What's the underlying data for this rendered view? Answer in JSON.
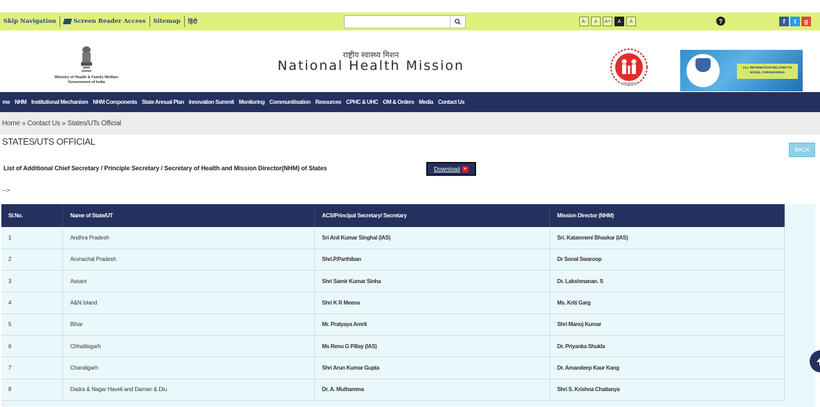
{
  "topbar": {
    "skip_navigation": "Skip Navigation",
    "screen_reader": "Screen Reader Access",
    "sitemap": "Sitemap",
    "hindi": "हिंदी",
    "search_placeholder": "",
    "search_icon": "search-icon",
    "font_sizes": [
      "A-",
      "A",
      "A+",
      "A",
      "A"
    ],
    "help_icon": "question-icon",
    "social": [
      {
        "icon": "facebook-icon",
        "glyph": "f",
        "color": "#3b5998"
      },
      {
        "icon": "twitter-icon",
        "glyph": "t",
        "color": "#1da1f2"
      },
      {
        "icon": "googleplus-icon",
        "glyph": "g",
        "color": "#dd4b39"
      }
    ]
  },
  "header": {
    "ministry_line1": "Ministry of Health & Family Welfare",
    "ministry_line2": "Government of India",
    "title_hindi": "राष्ट्रीय स्वास्थ्य मिशन",
    "title": "National Health Mission",
    "banner_text": "ALL INFORMATION RELATED TO NOVEL CORONAVIRUS"
  },
  "nav": {
    "items": [
      "me",
      "NHM",
      "Institutional Mechanism",
      "NHM Components",
      "State Annual Plan",
      "Innovation Summit",
      "Monitoring",
      "Communitisation",
      "Resources",
      "CPHC & UHC",
      "OM & Orders",
      "Media",
      "Contact Us"
    ]
  },
  "breadcrumb": "Home » Contact Us » States/UTs Official",
  "page": {
    "title": "STATES/UTS OFFICIAL",
    "back_label": "BACK",
    "list_heading": "List of Additional Chief Secretary / Principle Secretary / Secretary of Health and Mission Director(NHM) of States",
    "download_label": "Download",
    "arrow_text": "-->"
  },
  "table": {
    "headers": [
      "Sl.No.",
      "Name of State/UT",
      "ACS/Principal Secretary/ Secretary",
      "Mission Director (NHM)"
    ],
    "rows": [
      [
        "1",
        "Andhra Pradesh",
        "Sri Anil Kumar Singhal (IAS)",
        "Sri. Katamneni Bhaskar (IAS)"
      ],
      [
        "2",
        "Arunachal Pradesh",
        "Shri.P.Parthiban",
        "Dr Sonal Swaroop"
      ],
      [
        "3",
        "Assam",
        "Shri Samir Kumar Sinha",
        "Dr. Lakshmanan. S"
      ],
      [
        "4",
        "A&N Island",
        "Shri K R Meena",
        "Ms. Kriti Garg"
      ],
      [
        "5",
        "Bihar",
        "Mr. Pratyaya Amrit",
        "Shri Manoj Kumar"
      ],
      [
        "6",
        "Chhattisgarh",
        "Ms Renu G Pillay (IAS)",
        "Dr. Priyanka Shukla"
      ],
      [
        "7",
        "Chandigarh",
        "Shri Arun Kumar Gupta",
        "Dr. Amandeep Kaur Kang"
      ],
      [
        "8",
        "Dadra & Nagar Haveli and Daman & Diu",
        "Dr. A. Muthamma",
        "Shri S. Krishna Chaitanya"
      ]
    ]
  }
}
